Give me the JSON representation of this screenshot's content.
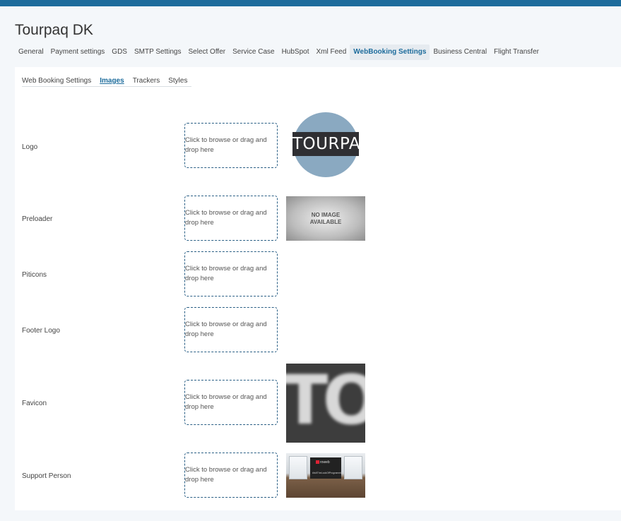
{
  "app": {
    "title": "Tourpaq DK"
  },
  "main_tabs": [
    {
      "label": "General",
      "active": false
    },
    {
      "label": "Payment settings",
      "active": false
    },
    {
      "label": "GDS",
      "active": false
    },
    {
      "label": "SMTP Settings",
      "active": false
    },
    {
      "label": "Select Offer",
      "active": false
    },
    {
      "label": "Service Case",
      "active": false
    },
    {
      "label": "HubSpot",
      "active": false
    },
    {
      "label": "Xml Feed",
      "active": false
    },
    {
      "label": "WebBooking Settings",
      "active": true
    },
    {
      "label": "Business Central",
      "active": false
    },
    {
      "label": "Flight Transfer",
      "active": false
    }
  ],
  "sub_tabs": [
    {
      "label": "Web Booking Settings",
      "active": false
    },
    {
      "label": "Images",
      "active": true
    },
    {
      "label": "Trackers",
      "active": false
    },
    {
      "label": "Styles",
      "active": false
    }
  ],
  "dropzone_text": "Click to browse or drag and drop here",
  "image_rows": [
    {
      "label": "Logo",
      "preview": "logo",
      "preview_text": "TOURPAQ"
    },
    {
      "label": "Preloader",
      "preview": "no-image",
      "preview_text": "NO IMAGE AVAILABLE"
    },
    {
      "label": "Piticons",
      "preview": "none"
    },
    {
      "label": "Footer Logo",
      "preview": "none"
    },
    {
      "label": "Favicon",
      "preview": "favicon",
      "preview_text": "TO"
    },
    {
      "label": "Support Person",
      "preview": "office-photo",
      "preview_text": "roweb",
      "preview_subtext": "#IsItTheLookOfProgramming"
    }
  ],
  "colors": {
    "accent": "#1d6c9c",
    "dropzone_border": "#2a5f85"
  }
}
